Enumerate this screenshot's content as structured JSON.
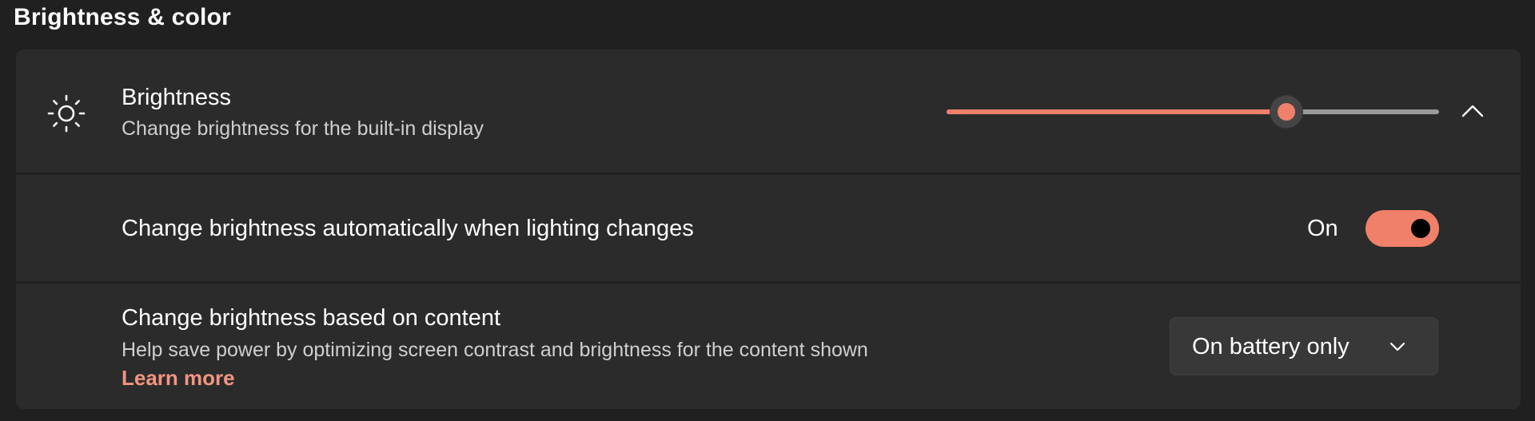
{
  "section": {
    "title": "Brightness & color"
  },
  "brightness": {
    "title": "Brightness",
    "description": "Change brightness for the built-in display",
    "level_percent": 69,
    "icon": "sun-icon",
    "expand_icon": "chevron-up-icon"
  },
  "auto_brightness": {
    "title": "Change brightness automatically when lighting changes",
    "state_label": "On",
    "enabled": true
  },
  "content_brightness": {
    "title": "Change brightness based on content",
    "description": "Help save power by optimizing screen contrast and brightness for the content shown",
    "learn_more": "Learn more",
    "selected": "On battery only",
    "dropdown_icon": "chevron-down-icon"
  },
  "colors": {
    "accent": "#f08069",
    "link": "#f39480",
    "background": "#202020",
    "card": "#2b2b2b"
  }
}
